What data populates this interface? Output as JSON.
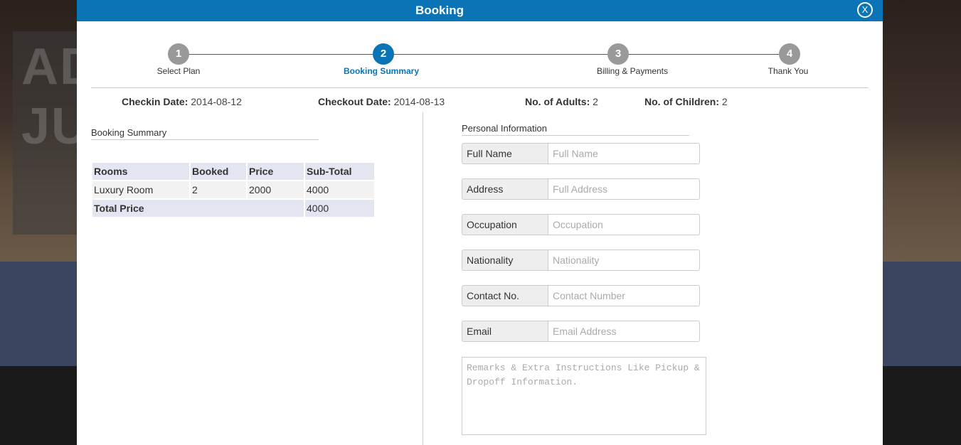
{
  "background": {
    "hero_text": [
      "AD",
      "JU"
    ]
  },
  "modal": {
    "title": "Booking",
    "close_label": "X"
  },
  "steps": [
    {
      "number": "1",
      "label": "Select Plan",
      "active": false
    },
    {
      "number": "2",
      "label": "Booking Summary",
      "active": true
    },
    {
      "number": "3",
      "label": "Billing & Payments",
      "active": false
    },
    {
      "number": "4",
      "label": "Thank You",
      "active": false
    }
  ],
  "booking_info": {
    "checkin_label": "Checkin Date:",
    "checkin_value": "2014-08-12",
    "checkout_label": "Checkout Date:",
    "checkout_value": "2014-08-13",
    "adults_label": "No. of Adults:",
    "adults_value": "2",
    "children_label": "No. of Children:",
    "children_value": "2"
  },
  "summary": {
    "title": "Booking Summary",
    "headers": [
      "Rooms",
      "Booked",
      "Price",
      "Sub-Total"
    ],
    "rows": [
      [
        "Luxury Room",
        "2",
        "2000",
        "4000"
      ]
    ],
    "total_label": "Total Price",
    "total_value": "4000"
  },
  "personal": {
    "title": "Personal Information",
    "fields": [
      {
        "label": "Full Name",
        "placeholder": "Full Name",
        "value": ""
      },
      {
        "label": "Address",
        "placeholder": "Full Address",
        "value": ""
      },
      {
        "label": "Occupation",
        "placeholder": "Occupation",
        "value": ""
      },
      {
        "label": "Nationality",
        "placeholder": "Nationality",
        "value": ""
      },
      {
        "label": "Contact No.",
        "placeholder": "Contact Number",
        "value": ""
      },
      {
        "label": "Email",
        "placeholder": "Email Address",
        "value": ""
      }
    ],
    "remarks_placeholder": "Remarks & Extra Instructions Like Pickup & Dropoff Information."
  },
  "colors": {
    "primary": "#0a74b7",
    "step_inactive": "#999999",
    "table_header_bg": "#e3e5f0"
  }
}
